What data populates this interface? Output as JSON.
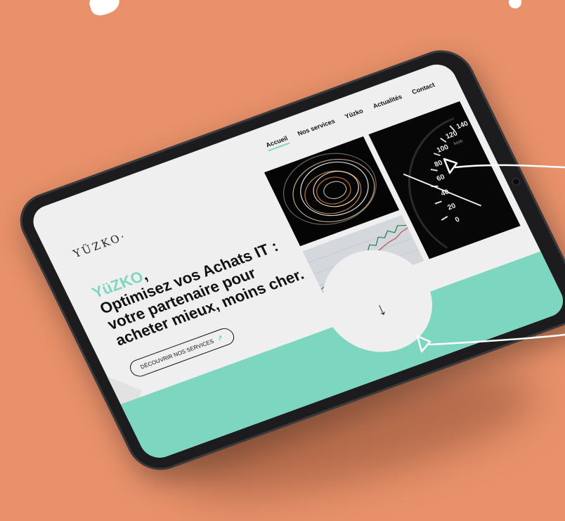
{
  "nav": {
    "items": [
      {
        "label": "Accueil",
        "active": true
      },
      {
        "label": "Nos services",
        "active": false
      },
      {
        "label": "Yüzko",
        "active": false
      },
      {
        "label": "Actualités",
        "active": false
      },
      {
        "label": "Contact",
        "active": false
      }
    ]
  },
  "logo": {
    "text": "YÜZKO·"
  },
  "hero": {
    "brand": "YüZKO",
    "brand_suffix": ",",
    "headline": "Optimisez vos Achats IT : votre partenaire pour acheter mieux, moins cher.",
    "cta_label": "DÉCOUVRIR NOS SERVICES",
    "cta_icon": "arrow-up-right-icon"
  },
  "speedometer": {
    "tick_labels": [
      "0",
      "20",
      "40",
      "60",
      "80",
      "100",
      "120",
      "140"
    ],
    "unit": "km/h"
  },
  "scroll": {
    "icon": "arrow-down-icon",
    "glyph": "↓"
  },
  "colors": {
    "background": "#e8916a",
    "accent": "#7dd6bf",
    "screen": "#efefef",
    "tablet": "#1c1c1e"
  }
}
